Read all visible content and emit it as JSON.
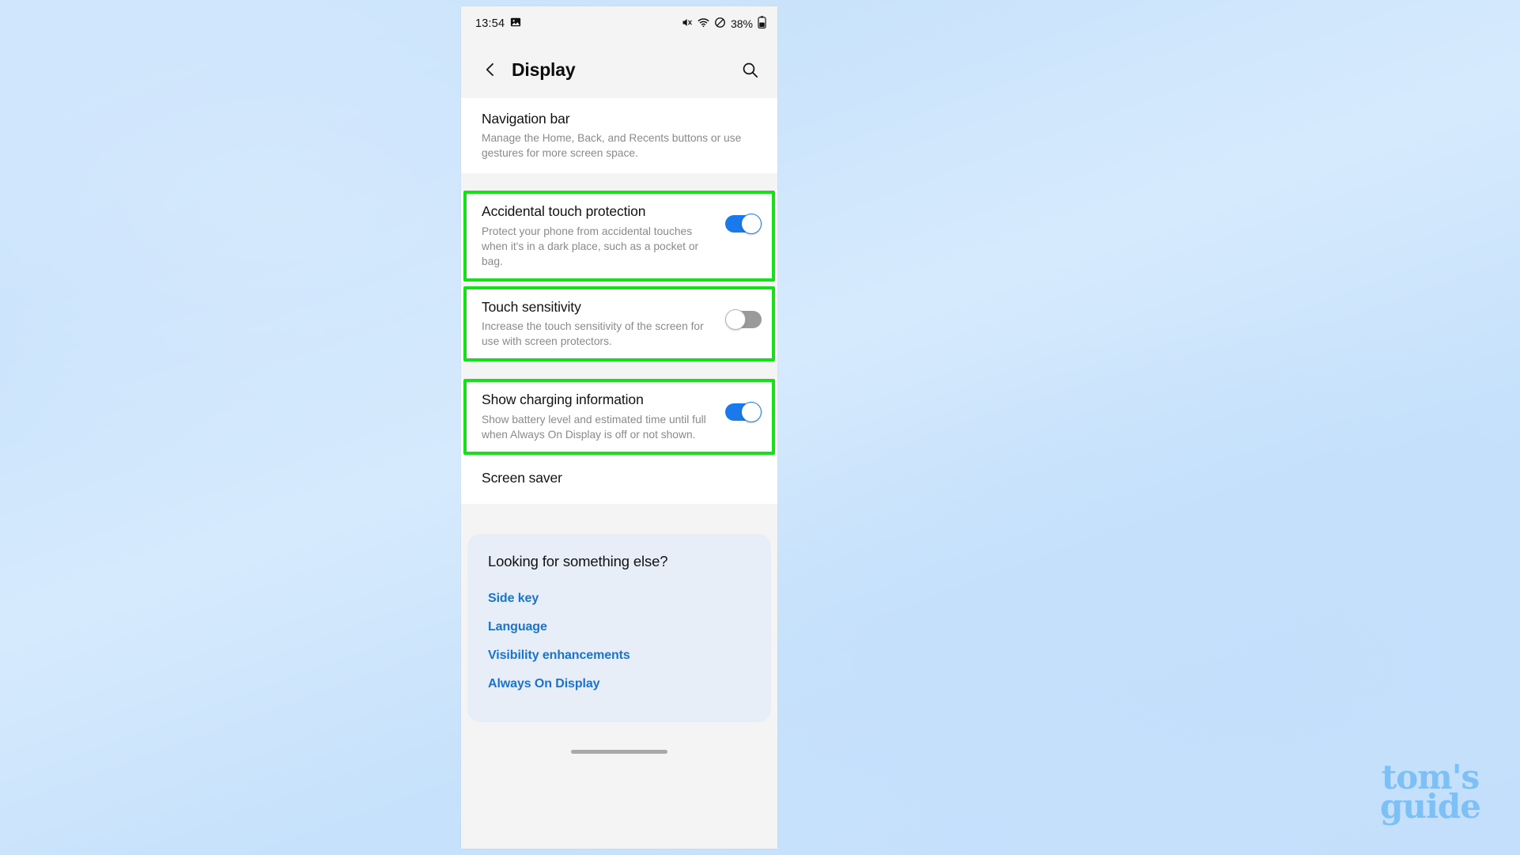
{
  "wallpaper": {
    "color_top": "#cfe6fc",
    "color_bottom": "#c3dffb"
  },
  "status_bar": {
    "time": "13:54",
    "left_icons": [
      "image-icon"
    ],
    "right_icons": [
      "mute-icon",
      "wifi-icon",
      "do-not-disturb-icon"
    ],
    "battery_percent": "38%",
    "battery_icon": "battery-icon"
  },
  "app_bar": {
    "back_icon": "chevron-left-icon",
    "title": "Display",
    "search_icon": "search-icon"
  },
  "settings": [
    {
      "id": "navigation-bar",
      "title": "Navigation bar",
      "subtitle": "Manage the Home, Back, and Recents buttons or use gestures for more screen space.",
      "toggle": null,
      "highlighted": false
    },
    {
      "id": "accidental-touch-protection",
      "title": "Accidental touch protection",
      "subtitle": "Protect your phone from accidental touches when it's in a dark place, such as a pocket or bag.",
      "toggle": "on",
      "highlighted": true
    },
    {
      "id": "touch-sensitivity",
      "title": "Touch sensitivity",
      "subtitle": "Increase the touch sensitivity of the screen for use with screen protectors.",
      "toggle": "off",
      "highlighted": true
    },
    {
      "id": "show-charging-information",
      "title": "Show charging information",
      "subtitle": "Show battery level and estimated time until full when Always On Display is off or not shown.",
      "toggle": "on",
      "highlighted": true
    },
    {
      "id": "screen-saver",
      "title": "Screen saver",
      "subtitle": "",
      "toggle": null,
      "highlighted": false
    }
  ],
  "looking_for_something_else": {
    "title": "Looking for something else?",
    "links": [
      "Side key",
      "Language",
      "Visibility enhancements",
      "Always On Display"
    ]
  },
  "home_indicator": {
    "name": "home-indicator"
  },
  "watermark": {
    "line1": "tom's",
    "line2": "guide",
    "color": "#7cc0f5"
  },
  "annotation": {
    "color": "#15e01a"
  }
}
